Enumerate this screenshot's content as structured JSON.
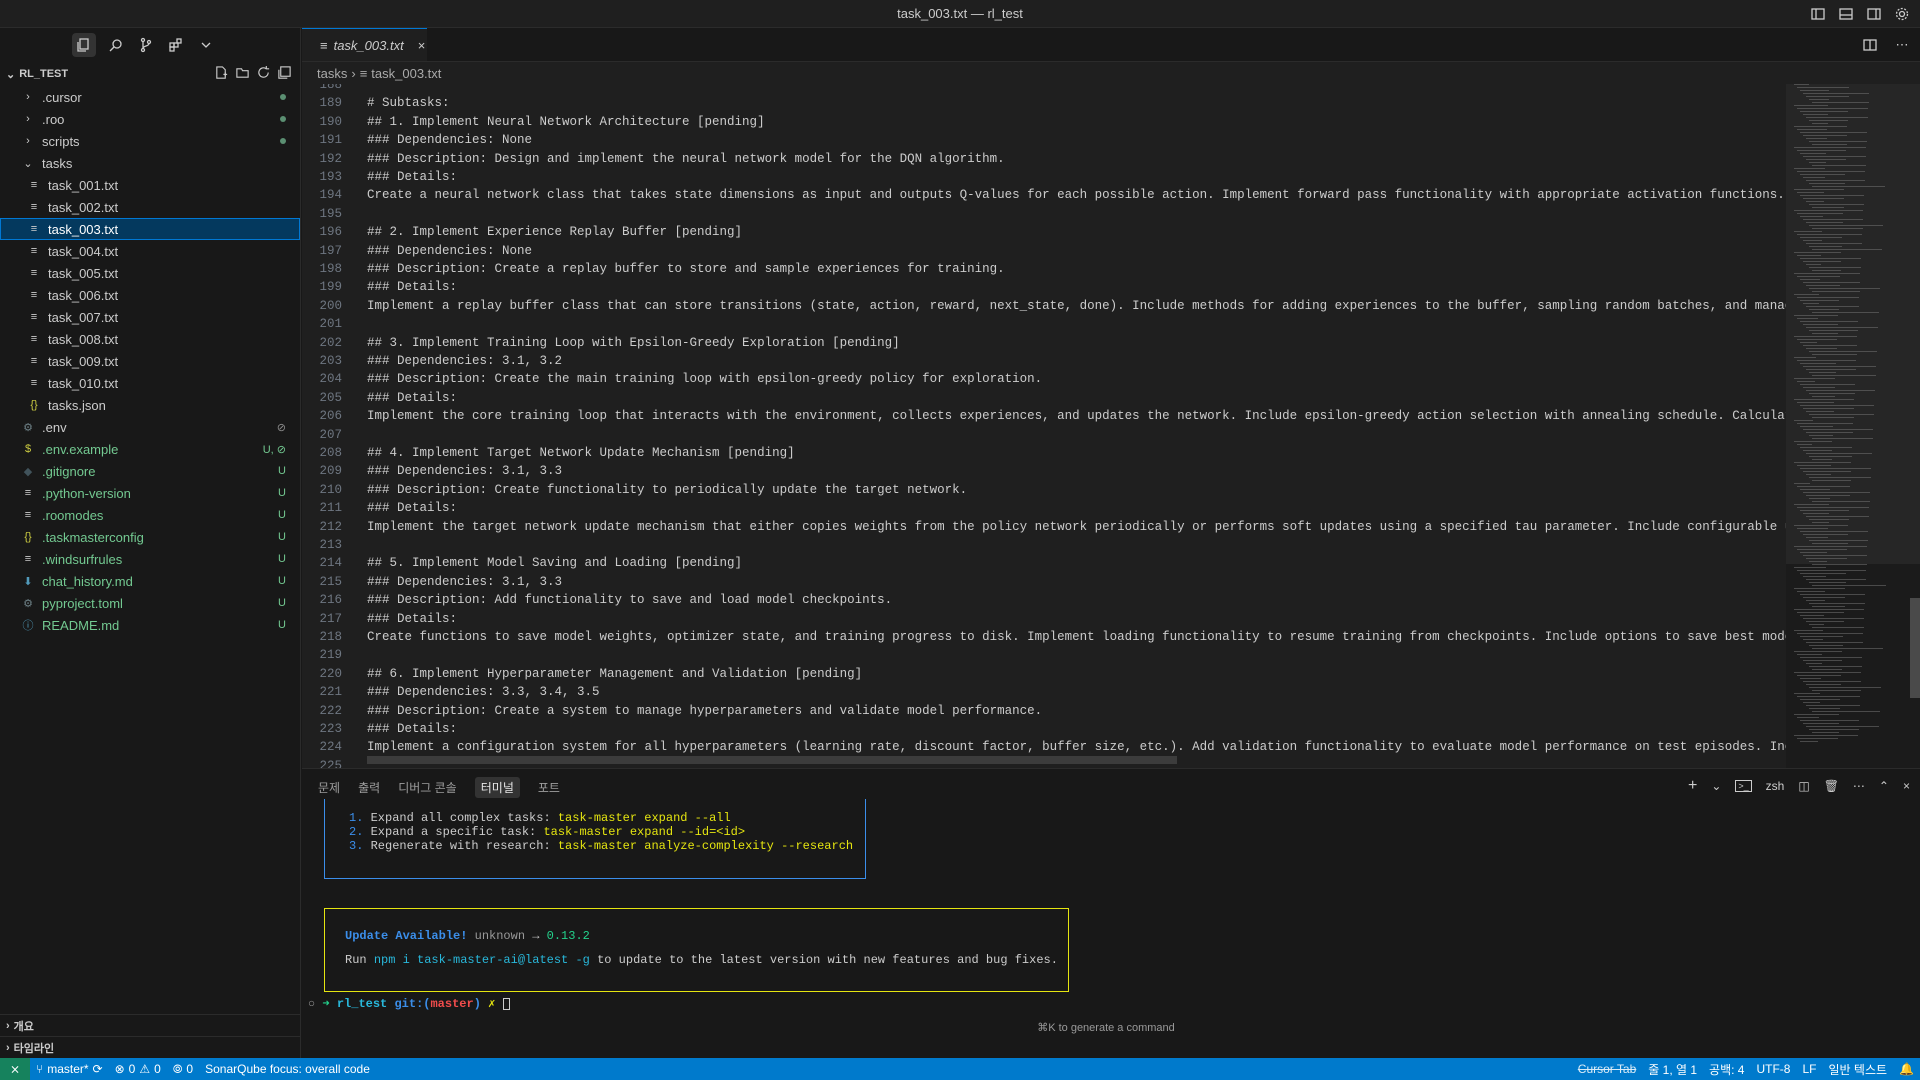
{
  "window": {
    "title": "task_003.txt — rl_test"
  },
  "explorer": {
    "root": "RL_TEST",
    "items": [
      {
        "label": ".cursor",
        "type": "folder",
        "status": "dot"
      },
      {
        "label": ".roo",
        "type": "folder",
        "status": "dot"
      },
      {
        "label": "scripts",
        "type": "folder",
        "status": "dot"
      },
      {
        "label": "tasks",
        "type": "folder-open",
        "status": ""
      },
      {
        "label": "task_001.txt",
        "type": "file",
        "status": ""
      },
      {
        "label": "task_002.txt",
        "type": "file",
        "status": ""
      },
      {
        "label": "task_003.txt",
        "type": "file",
        "status": "",
        "selected": true
      },
      {
        "label": "task_004.txt",
        "type": "file",
        "status": ""
      },
      {
        "label": "task_005.txt",
        "type": "file",
        "status": ""
      },
      {
        "label": "task_006.txt",
        "type": "file",
        "status": ""
      },
      {
        "label": "task_007.txt",
        "type": "file",
        "status": ""
      },
      {
        "label": "task_008.txt",
        "type": "file",
        "status": ""
      },
      {
        "label": "task_009.txt",
        "type": "file",
        "status": ""
      },
      {
        "label": "task_010.txt",
        "type": "file",
        "status": ""
      },
      {
        "label": "tasks.json",
        "type": "json",
        "status": ""
      },
      {
        "label": ".env",
        "type": "gear",
        "status": "⊘"
      },
      {
        "label": ".env.example",
        "type": "dollar",
        "status": "U, ⊘"
      },
      {
        "label": ".gitignore",
        "type": "git",
        "status": "U"
      },
      {
        "label": ".python-version",
        "type": "file",
        "status": "U"
      },
      {
        "label": ".roomodes",
        "type": "file",
        "status": "U"
      },
      {
        "label": ".taskmasterconfig",
        "type": "json",
        "status": "U"
      },
      {
        "label": ".windsurfrules",
        "type": "file",
        "status": "U"
      },
      {
        "label": "chat_history.md",
        "type": "md",
        "status": "U"
      },
      {
        "label": "pyproject.toml",
        "type": "gear",
        "status": "U"
      },
      {
        "label": "README.md",
        "type": "info",
        "status": "U"
      }
    ],
    "bottom": [
      "개요",
      "타임라인"
    ]
  },
  "editor": {
    "tab": "task_003.txt",
    "breadcrumb": [
      "tasks",
      "task_003.txt"
    ],
    "lines": [
      {
        "n": "188",
        "t": ""
      },
      {
        "n": "189",
        "t": "# Subtasks:"
      },
      {
        "n": "190",
        "t": "## 1. Implement Neural Network Architecture [pending]"
      },
      {
        "n": "191",
        "t": "### Dependencies: None"
      },
      {
        "n": "192",
        "t": "### Description: Design and implement the neural network model for the DQN algorithm."
      },
      {
        "n": "193",
        "t": "### Details:"
      },
      {
        "n": "194",
        "t": "Create a neural network class that takes state dimensions as input and outputs Q-values for each possible action. Implement forward pass functionality with appropriate activation functions. The arc"
      },
      {
        "n": "195",
        "t": ""
      },
      {
        "n": "196",
        "t": "## 2. Implement Experience Replay Buffer [pending]"
      },
      {
        "n": "197",
        "t": "### Dependencies: None"
      },
      {
        "n": "198",
        "t": "### Description: Create a replay buffer to store and sample experiences for training."
      },
      {
        "n": "199",
        "t": "### Details:"
      },
      {
        "n": "200",
        "t": "Implement a replay buffer class that can store transitions (state, action, reward, next_state, done). Include methods for adding experiences to the buffer, sampling random batches, and managing buf"
      },
      {
        "n": "201",
        "t": ""
      },
      {
        "n": "202",
        "t": "## 3. Implement Training Loop with Epsilon-Greedy Exploration [pending]"
      },
      {
        "n": "203",
        "t": "### Dependencies: 3.1, 3.2"
      },
      {
        "n": "204",
        "t": "### Description: Create the main training loop with epsilon-greedy policy for exploration."
      },
      {
        "n": "205",
        "t": "### Details:"
      },
      {
        "n": "206",
        "t": "Implement the core training loop that interacts with the environment, collects experiences, and updates the network. Include epsilon-greedy action selection with annealing schedule. Calculate loss"
      },
      {
        "n": "207",
        "t": ""
      },
      {
        "n": "208",
        "t": "## 4. Implement Target Network Update Mechanism [pending]"
      },
      {
        "n": "209",
        "t": "### Dependencies: 3.1, 3.3"
      },
      {
        "n": "210",
        "t": "### Description: Create functionality to periodically update the target network."
      },
      {
        "n": "211",
        "t": "### Details:"
      },
      {
        "n": "212",
        "t": "Implement the target network update mechanism that either copies weights from the policy network periodically or performs soft updates using a specified tau parameter. Include configurable update f"
      },
      {
        "n": "213",
        "t": ""
      },
      {
        "n": "214",
        "t": "## 5. Implement Model Saving and Loading [pending]"
      },
      {
        "n": "215",
        "t": "### Dependencies: 3.1, 3.3"
      },
      {
        "n": "216",
        "t": "### Description: Add functionality to save and load model checkpoints."
      },
      {
        "n": "217",
        "t": "### Details:"
      },
      {
        "n": "218",
        "t": "Create functions to save model weights, optimizer state, and training progress to disk. Implement loading functionality to resume training from checkpoints. Include options to save best models base"
      },
      {
        "n": "219",
        "t": ""
      },
      {
        "n": "220",
        "t": "## 6. Implement Hyperparameter Management and Validation [pending]"
      },
      {
        "n": "221",
        "t": "### Dependencies: 3.3, 3.4, 3.5"
      },
      {
        "n": "222",
        "t": "### Description: Create a system to manage hyperparameters and validate model performance."
      },
      {
        "n": "223",
        "t": "### Details:"
      },
      {
        "n": "224",
        "t": "Implement a configuration system for all hyperparameters (learning rate, discount factor, buffer size, etc.). Add validation functionality to evaluate model performance on test episodes. Include vi"
      },
      {
        "n": "225",
        "t": ""
      }
    ]
  },
  "panel": {
    "tabs": [
      "문제",
      "출력",
      "디버그 콘솔",
      "터미널",
      "포트"
    ],
    "active_tab": "터미널",
    "shell": "zsh",
    "steps": [
      {
        "num": "1.",
        "text": "Expand all complex tasks: ",
        "cmd": "task-master expand --all"
      },
      {
        "num": "2.",
        "text": "Expand a specific task: ",
        "cmd": "task-master expand --id=<id>"
      },
      {
        "num": "3.",
        "text": "Regenerate with research: ",
        "cmd": "task-master analyze-complexity --research"
      }
    ],
    "update": {
      "title": "Update Available!",
      "from": "unknown",
      "arrow": "→",
      "to": "0.13.2",
      "run": "Run",
      "cmd": "npm i task-master-ai@latest -g",
      "rest": "to update to the latest version with new features and bug fixes."
    },
    "prompt": {
      "dir": "rl_test",
      "git": "git:(",
      "branch": "master",
      "close": ")",
      "mark": "✗"
    },
    "hint": "⌘K to generate a command"
  },
  "status": {
    "branch": "master*",
    "errors": "0",
    "warnings": "0",
    "ports": "0",
    "sonar": "SonarQube focus: overall code",
    "cursor_tab": "Cursor Tab",
    "position": "줄 1, 열 1",
    "spaces": "공백: 4",
    "encoding": "UTF-8",
    "eol": "LF",
    "language": "일반 텍스트"
  }
}
